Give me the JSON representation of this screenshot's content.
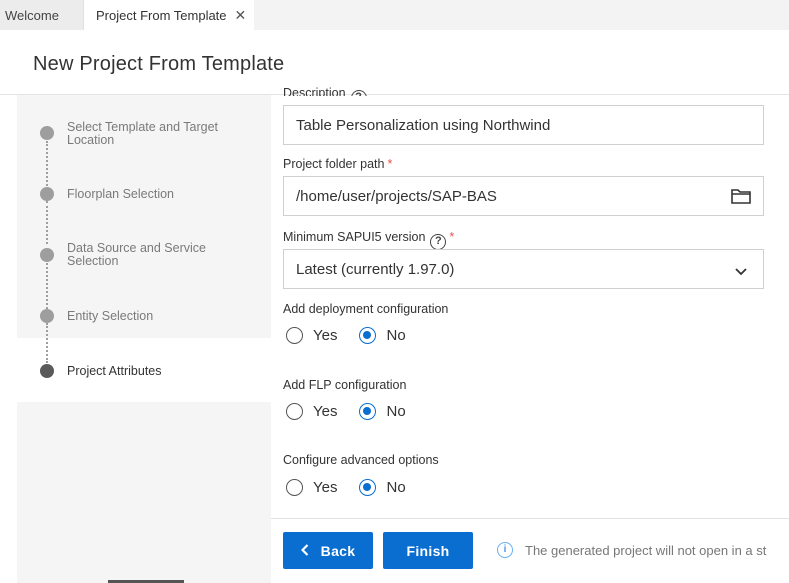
{
  "tabs": [
    {
      "label": "Welcome",
      "active": false
    },
    {
      "label": "Project From Template",
      "active": true
    }
  ],
  "page_title": "New Project From Template",
  "steps": [
    {
      "label": "Select Template and Target Location",
      "state": "done"
    },
    {
      "label": "Floorplan Selection",
      "state": "done"
    },
    {
      "label": "Data Source and Service Selection",
      "state": "done"
    },
    {
      "label": "Entity Selection",
      "state": "done"
    },
    {
      "label": "Project Attributes",
      "state": "current"
    }
  ],
  "form": {
    "description": {
      "label": "Description",
      "value": "Table Personalization using Northwind"
    },
    "folder": {
      "label": "Project folder path",
      "value": "/home/user/projects/SAP-BAS"
    },
    "ui5": {
      "label": "Minimum SAPUI5 version",
      "value": "Latest (currently 1.97.0)"
    },
    "deploy": {
      "label": "Add deployment configuration",
      "yes": "Yes",
      "no": "No",
      "selected": "No"
    },
    "flp": {
      "label": "Add FLP configuration",
      "yes": "Yes",
      "no": "No",
      "selected": "No"
    },
    "advanced": {
      "label": "Configure advanced options",
      "yes": "Yes",
      "no": "No",
      "selected": "No"
    }
  },
  "footer": {
    "back_label": "Back",
    "finish_label": "Finish",
    "info_text": "The generated project will not open in a st"
  },
  "colors": {
    "accent": "#0a6ed1",
    "required": "#e5544a",
    "sidebar": "#f5f5f5"
  }
}
